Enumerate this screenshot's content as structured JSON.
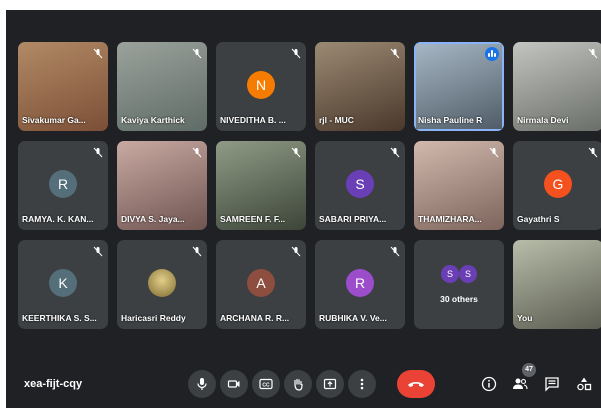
{
  "meeting": {
    "code": "xea-fijt-cqy",
    "participant_count": "47"
  },
  "tiles": [
    {
      "name": "Sivakumar Ga...",
      "type": "video",
      "bg": "#8a6b52"
    },
    {
      "name": "Kaviya Karthick",
      "type": "video",
      "bg": "#7a7f7a"
    },
    {
      "name": "NIVEDITHA B. ...",
      "type": "avatar",
      "initial": "N",
      "color": "#f57c00"
    },
    {
      "name": "rjl - MUC",
      "type": "video",
      "bg": "#6b5a4a"
    },
    {
      "name": "Nisha Pauline R",
      "type": "video",
      "bg": "#7d8c99",
      "speaking": true
    },
    {
      "name": "Nirmala Devi",
      "type": "video",
      "bg": "#8d8f8c"
    },
    {
      "name": "RAMYA. K. KAN...",
      "type": "avatar",
      "initial": "R",
      "color": "#546e7a"
    },
    {
      "name": "DIVYA S. Jaya...",
      "type": "video",
      "bg": "#9a7d78"
    },
    {
      "name": "SAMREEN F. F...",
      "type": "video",
      "bg": "#5e6b5c"
    },
    {
      "name": "SABARI PRIYA...",
      "type": "avatar",
      "initial": "S",
      "color": "#6a3fb5"
    },
    {
      "name": "THAMIZHARA...",
      "type": "video",
      "bg": "#a98f85"
    },
    {
      "name": "Gayathri S",
      "type": "avatar",
      "initial": "G",
      "color": "#f4511e"
    },
    {
      "name": "KEERTHIKA S. S...",
      "type": "avatar",
      "initial": "K",
      "color": "#546e7a"
    },
    {
      "name": "Haricasri Reddy",
      "type": "photo-avatar",
      "color": "#c9b26a"
    },
    {
      "name": "ARCHANA R. R...",
      "type": "avatar",
      "initial": "A",
      "color": "#8d4d3f"
    },
    {
      "name": "RUBHIKA V. Ve...",
      "type": "avatar",
      "initial": "R",
      "color": "#9c4dcc"
    },
    {
      "name": "30 others",
      "type": "others",
      "initials": [
        "S",
        "S"
      ]
    },
    {
      "name": "You",
      "type": "video",
      "bg": "#8b8f7e"
    }
  ],
  "icons": [
    "mic-icon",
    "camera-icon",
    "captions-icon",
    "raise-hand-icon",
    "present-icon",
    "more-options-icon",
    "hang-up-icon",
    "info-icon",
    "people-icon",
    "chat-icon",
    "activities-icon"
  ],
  "colors": {
    "background": "#202124",
    "tile": "#3c4043",
    "accent": "#1a73e8",
    "hangup": "#ea4335"
  }
}
